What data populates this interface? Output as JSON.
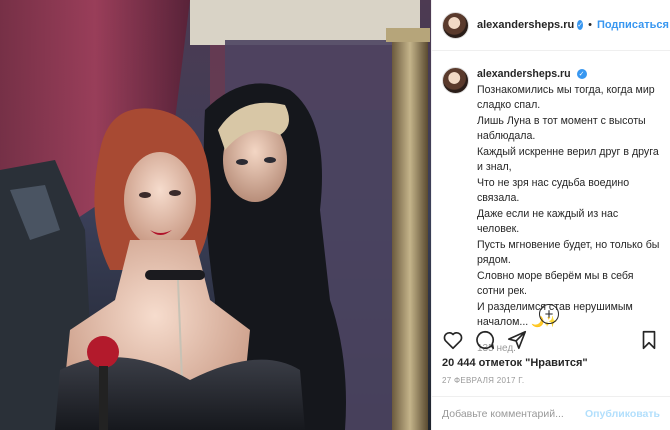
{
  "header": {
    "username": "alexandersheps.ru",
    "verified_mark": "✓",
    "separator": "•",
    "follow_label": "Подписаться"
  },
  "caption": {
    "username": "alexandersheps.ru",
    "lines": [
      "Познакомились мы тогда, когда мир сладко спал.",
      "Лишь Луна в тот момент с высоты наблюдала.",
      "Каждый искренне верил друг в друга и знал,",
      "Что не зря нас судьба воедино связала.",
      "Даже если не каждый из нас человек.",
      "Пусть мгновение будет, но только бы рядом.",
      "Словно море вберём мы в себя сотни рек.",
      "И разделимся став нерушимым началом... 🌙✨"
    ],
    "time_ago": "135 нед."
  },
  "load_more_label": "+",
  "likes": {
    "count": "20 444",
    "text": "отметок \"Нравится\""
  },
  "date": "27 ФЕВРАЛЯ 2017 Г.",
  "comment_input": {
    "placeholder": "Добавьте комментарий...",
    "value": ""
  },
  "publish_label": "Опубликовать",
  "colors": {
    "accent": "#3897f0",
    "publish_disabled": "#b2dffc",
    "muted_text": "#999999",
    "border": "#efefef"
  },
  "icons": [
    "heart-icon",
    "comment-icon",
    "share-icon",
    "bookmark-icon",
    "plus-circle-icon",
    "verified-icon"
  ]
}
